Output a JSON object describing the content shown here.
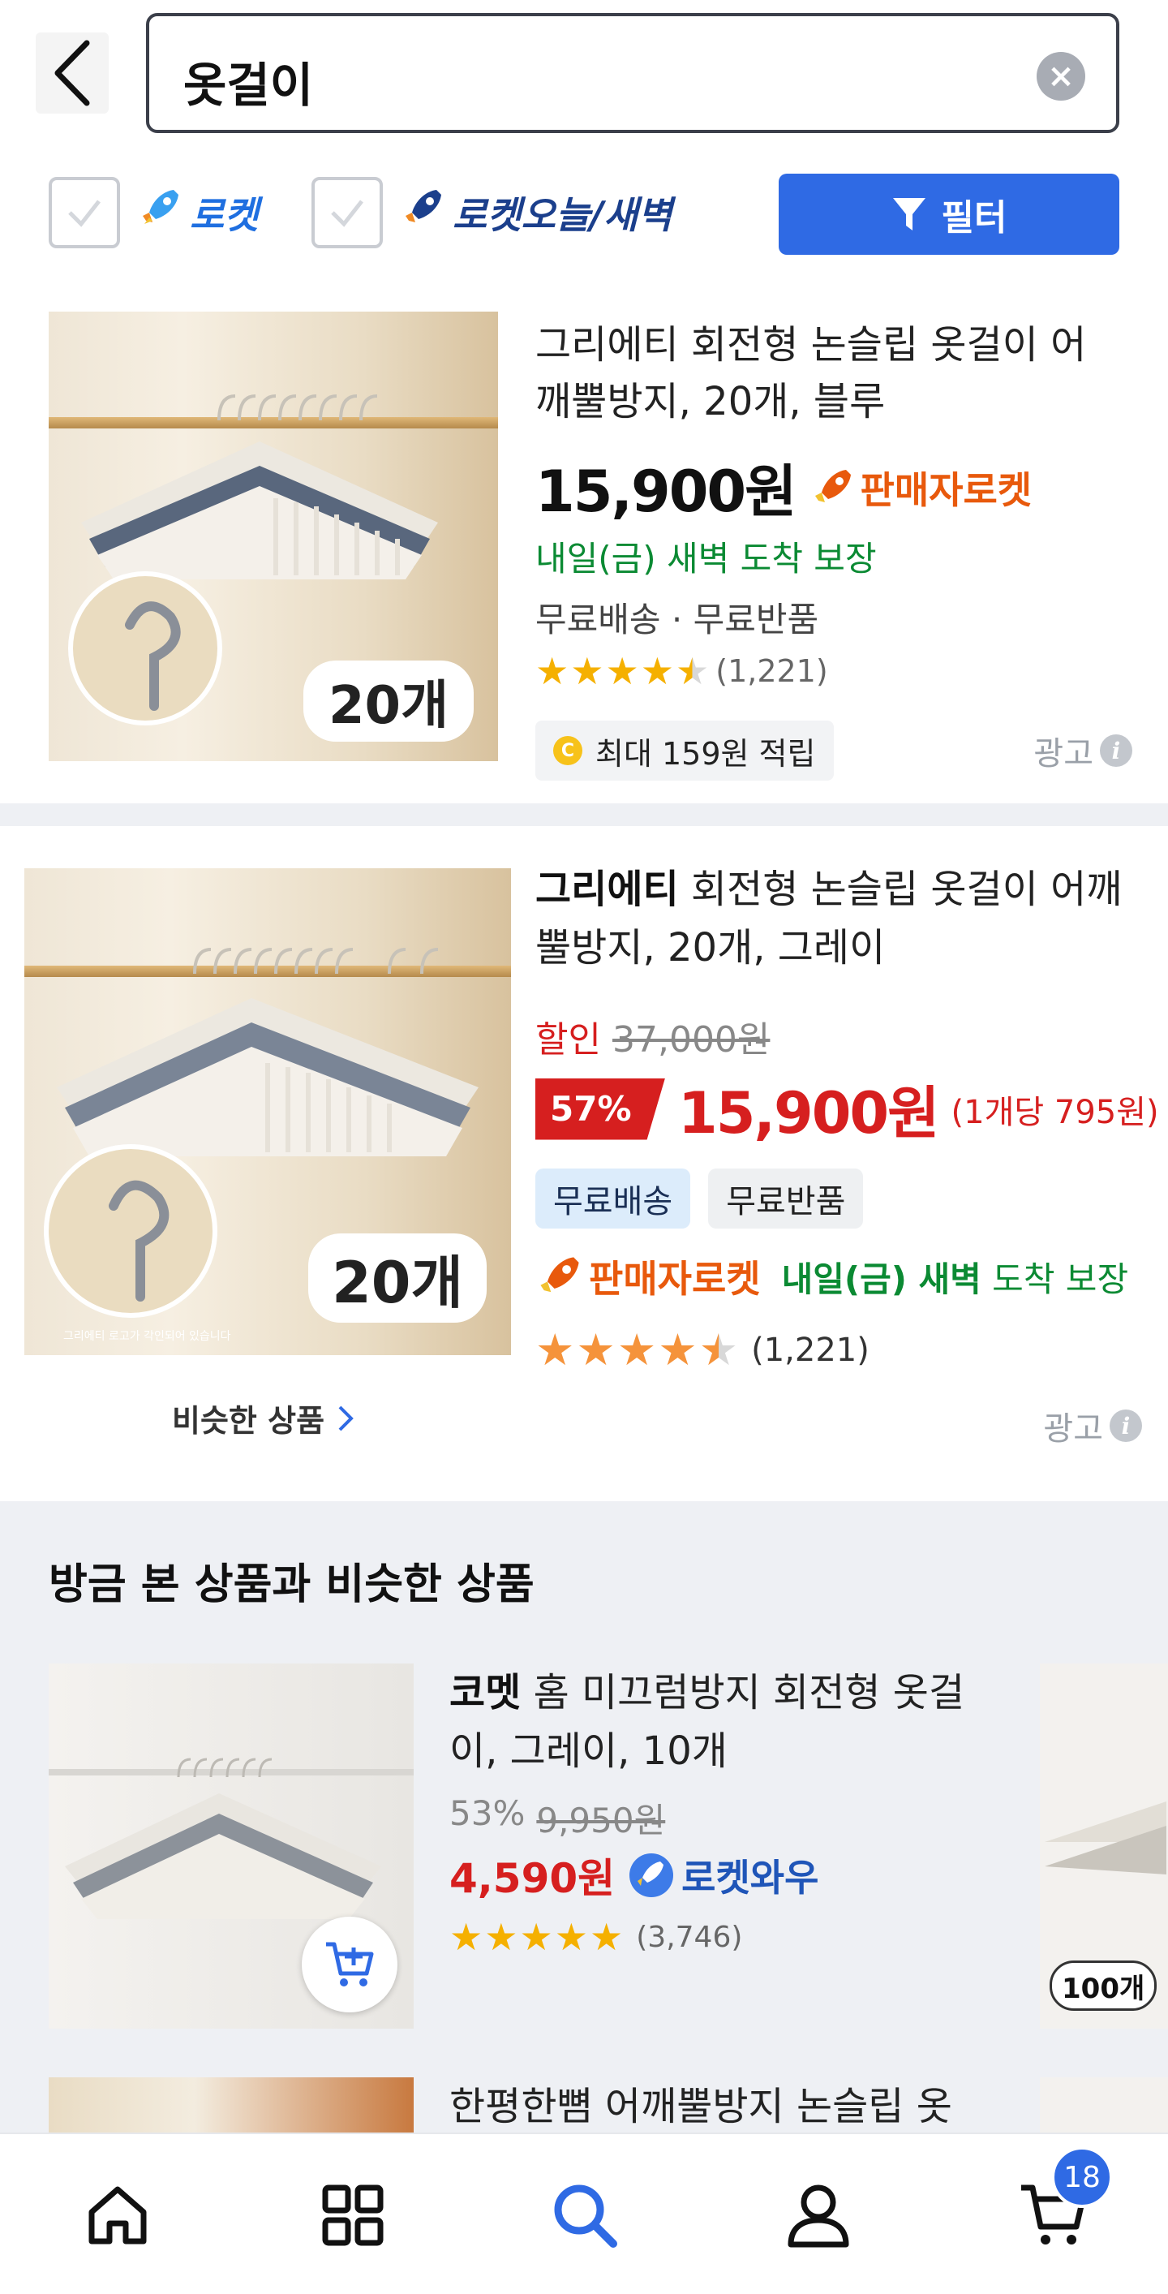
{
  "search": {
    "query": "옷걸이"
  },
  "filters": {
    "rocket_label": "로켓",
    "rocket_fresh_label": "로켓오늘/새벽",
    "filter_button": "필터"
  },
  "products": [
    {
      "title": "그리에티 회전형 논슬립 옷걸이 어깨뿔방지, 20개, 블루",
      "price": "15,900원",
      "seller_rocket": "판매자로켓",
      "delivery": "내일(금) 새벽 도착 보장",
      "shipping": "무료배송 · 무료반품",
      "rating": 4.5,
      "review_count": "(1,221)",
      "cashback": "최대 159원 적립",
      "cashback_coin": "C",
      "ad_label": "광고",
      "image_badge": "20개"
    },
    {
      "brand": "그리에티",
      "title_rest": " 회전형 논슬립 옷걸이 어깨뿔방지, 20개, 그레이",
      "discount_label": "할인",
      "original_price": "37,000원",
      "discount_percent": "57%",
      "price": "15,900원",
      "unit_price": "(1개당 795원)",
      "tag_free_shipping": "무료배송",
      "tag_free_return": "무료반품",
      "seller_rocket": "판매자로켓",
      "delivery_bold": "내일(금) 새벽",
      "delivery_rest": " 도착 보장",
      "rating": 4.5,
      "review_count": "(1,221)",
      "similar_link": "비슷한 상품",
      "ad_label": "광고",
      "image_badge": "20개",
      "image_caption": "그리에티 로고가 각인되어 있습니다"
    }
  ],
  "recommendations": {
    "title": "방금 본 상품과 비슷한 상품",
    "items": [
      {
        "brand": "코멧",
        "title_rest": " 홈 미끄럼방지 회전형 옷걸이, 그레이, 10개",
        "discount_percent": "53%",
        "original_price": "9,950원",
        "price": "4,590원",
        "rocket_wow": "로켓와우",
        "rating": 5,
        "review_count": "(3,746)"
      },
      {
        "title": "한평한뼘 어깨뿔방지 논슬립 옷"
      }
    ],
    "side_badge": "100개"
  },
  "bottom_nav": {
    "items": [
      "home-icon",
      "category-icon",
      "search-icon",
      "my-icon",
      "cart-icon"
    ],
    "cart_count": "18",
    "active_color": "#2f6ae4"
  }
}
